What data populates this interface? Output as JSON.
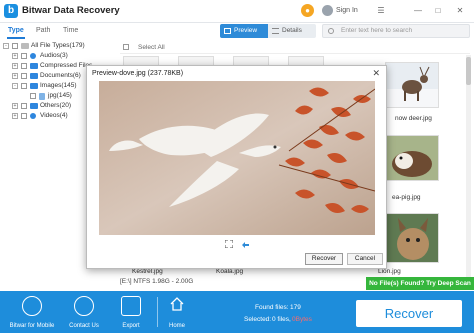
{
  "app": {
    "title": "Bitwar Data Recovery",
    "logo_letter": "b",
    "signin": "Sign In"
  },
  "sidebar": {
    "tabs": [
      {
        "label": "Type"
      },
      {
        "label": "Path"
      },
      {
        "label": "Time"
      }
    ],
    "tree": [
      {
        "label": "All File Types(179)"
      },
      {
        "label": "Audios(3)"
      },
      {
        "label": "Compressed Files"
      },
      {
        "label": "Documents(6)"
      },
      {
        "label": "Images(145)"
      },
      {
        "label": "jpg(145)"
      },
      {
        "label": "Others(20)"
      },
      {
        "label": "Videos(4)"
      }
    ]
  },
  "toolbar": {
    "preview_label": "Preview",
    "details_label": "Details",
    "search_placeholder": "Enter text here to search"
  },
  "list": {
    "select_all": "Select All",
    "thumb_labels": {
      "snow_deer": "now deer.jpg",
      "guinea_pig": "ea-pig.jpg",
      "kestrel": "Kestrel.jpg",
      "koala": "Koala.jpg",
      "lion": "Lion.jpg"
    },
    "drive_info": "[E:\\] NTFS 1.98G - 2.00G",
    "deep_scan": "No File(s) Found? Try Deep Scan"
  },
  "preview_dialog": {
    "title": "Preview-dove.jpg (237.78KB)",
    "recover": "Recover",
    "cancel": "Cancel"
  },
  "bottom": {
    "items": [
      {
        "label": "Bitwar for Mobile"
      },
      {
        "label": "Contact Us"
      },
      {
        "label": "Export"
      }
    ],
    "home": "Home",
    "found_label": "Found files:",
    "found_count": "179",
    "selected_label": "Selected:",
    "selected_files": "0 files,",
    "selected_size": "0Bytes",
    "recover": "Recover"
  },
  "colors": {
    "accent": "#1e8ddb",
    "deep_scan_green": "#35b63c",
    "cart_orange": "#f5a623"
  }
}
